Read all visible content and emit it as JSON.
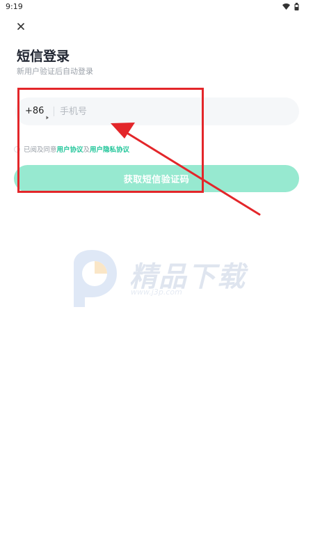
{
  "status": {
    "time": "9:19"
  },
  "icons": {
    "close": "close-icon",
    "wifi": "wifi-icon",
    "battery": "battery-icon",
    "caret": "caret-right-icon"
  },
  "header": {
    "title": "短信登录",
    "subtitle": "新用户验证后自动登录"
  },
  "phone": {
    "country_code": "+86",
    "placeholder": "手机号"
  },
  "agreement": {
    "prefix": "已阅及同意",
    "user_agreement": "用户协议",
    "conjunction": "及",
    "privacy_agreement": "用户隐私协议"
  },
  "actions": {
    "get_code_label": "获取短信验证码"
  },
  "watermark": {
    "text": "精品下载",
    "url": "www.j3p.com"
  },
  "colors": {
    "accent": "#22c69a",
    "button": "#97e9d0",
    "annotation": "#e3262a",
    "input_bg": "#f5f7f9"
  }
}
